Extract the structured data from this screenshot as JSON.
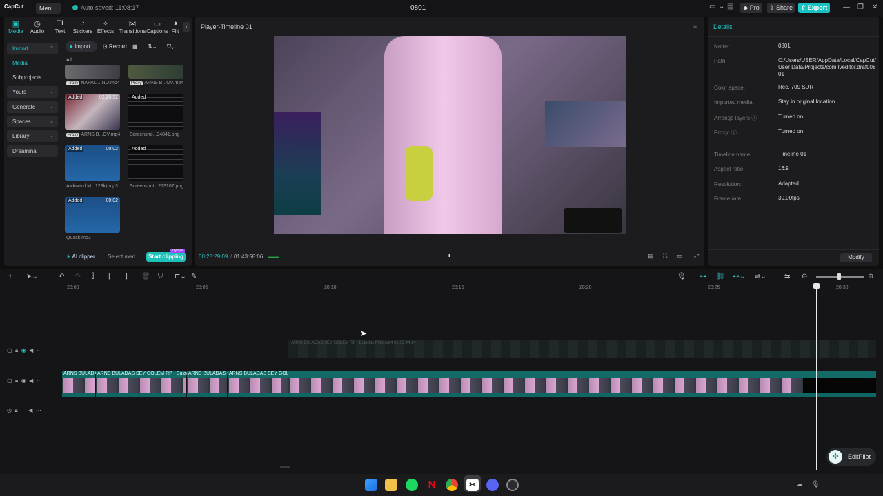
{
  "titlebar": {
    "logo": "CapCut",
    "menu": "Menu",
    "autosave": "Auto saved: 11:08:17",
    "project_title": "0801",
    "pro": "Pro",
    "share": "Share",
    "export": "Export"
  },
  "toolbar_tabs": [
    {
      "label": "Media",
      "icon": "media-icon"
    },
    {
      "label": "Audio",
      "icon": "audio-icon"
    },
    {
      "label": "Text",
      "icon": "text-icon"
    },
    {
      "label": "Stickers",
      "icon": "stickers-icon"
    },
    {
      "label": "Effects",
      "icon": "effects-icon"
    },
    {
      "label": "Transitions",
      "icon": "transitions-icon"
    },
    {
      "label": "Captions",
      "icon": "captions-icon"
    },
    {
      "label": "Filt",
      "icon": "filters-icon"
    }
  ],
  "sidebar": {
    "items": [
      {
        "label": "Import"
      },
      {
        "label": "Media"
      },
      {
        "label": "Subprojects"
      },
      {
        "label": "Yours"
      },
      {
        "label": "Generate"
      },
      {
        "label": "Spaces"
      },
      {
        "label": "Library"
      },
      {
        "label": "Dreamina"
      }
    ]
  },
  "media_toolbar": {
    "import": "Import",
    "record": "Record",
    "all": "All"
  },
  "media_items": [
    {
      "name": "NAPALI...NO.mp4",
      "proxy": "Proxy"
    },
    {
      "name": "ARNS B...OV.mp4",
      "proxy": "Proxy"
    },
    {
      "name": "ARNS B...OV.mp4",
      "proxy": "Proxy",
      "status": "Added",
      "duration": "02:20:32"
    },
    {
      "name": "Screensho...94841.png",
      "status": "Added"
    },
    {
      "name": "Awkward M...128k).mp3",
      "status": "Added",
      "duration": "00:02"
    },
    {
      "name": "Screenshot...213107.png",
      "status": "Added"
    },
    {
      "name": "Quack.mp3",
      "status": "Added",
      "duration": "00:02"
    }
  ],
  "media_footer": {
    "ai_clipper": "AI clipper",
    "select_media": "Select med...",
    "start_clipping": "Start clipping",
    "try_free": "Try free"
  },
  "player": {
    "title": "Player-Timeline 01",
    "current_time": "00:28:29:09",
    "total_time": "01:43:58:06"
  },
  "details": {
    "title": "Details",
    "rows": [
      {
        "label": "Name:",
        "value": "0801"
      },
      {
        "label": "Path:",
        "value": "C:/Users/USER/AppData/Local/CapCut/User Data/Projects/com.lveditor.draft/0801"
      },
      {
        "label": "Color space:",
        "value": "Rec. 709 SDR"
      },
      {
        "label": "Imported media:",
        "value": "Stay in original location"
      },
      {
        "label": "Arrange layers",
        "value": "Turned on"
      },
      {
        "label": "Proxy:",
        "value": "Turned on"
      },
      {
        "label": "Timeline name:",
        "value": "Timeline 01"
      },
      {
        "label": "Aspect ratio:",
        "value": "16:9"
      },
      {
        "label": "Resolution:",
        "value": "Adapted"
      },
      {
        "label": "Frame rate:",
        "value": "30.00fps"
      }
    ],
    "modify": "Modify"
  },
  "timeline": {
    "ruler": [
      "28:00",
      "28:05",
      "28:10",
      "28:15",
      "28:20",
      "28:25",
      "28:30"
    ],
    "ghost_clip": "ARNS BULADAS SEY GOLEM RP - Buladas POV.mp4   01:15:44:14",
    "clips": [
      {
        "label": "ARNS BULADAS"
      },
      {
        "label": "ARNS BULADAS SEY GOLEM RP - Bulada"
      },
      {
        "label": "ARNS BULADAS S"
      },
      {
        "label": "ARNS BULADAS SEY GOLEM"
      },
      {
        "label": "ARNS BULADAS SEY GOLEM RP - Buladas  POV.mp4   01:15:44:14"
      }
    ],
    "editpilot": "EditPilot"
  },
  "colors": {
    "accent": "#26c6c6",
    "export": "#19c2c2",
    "clip_teal": "#126b66"
  }
}
